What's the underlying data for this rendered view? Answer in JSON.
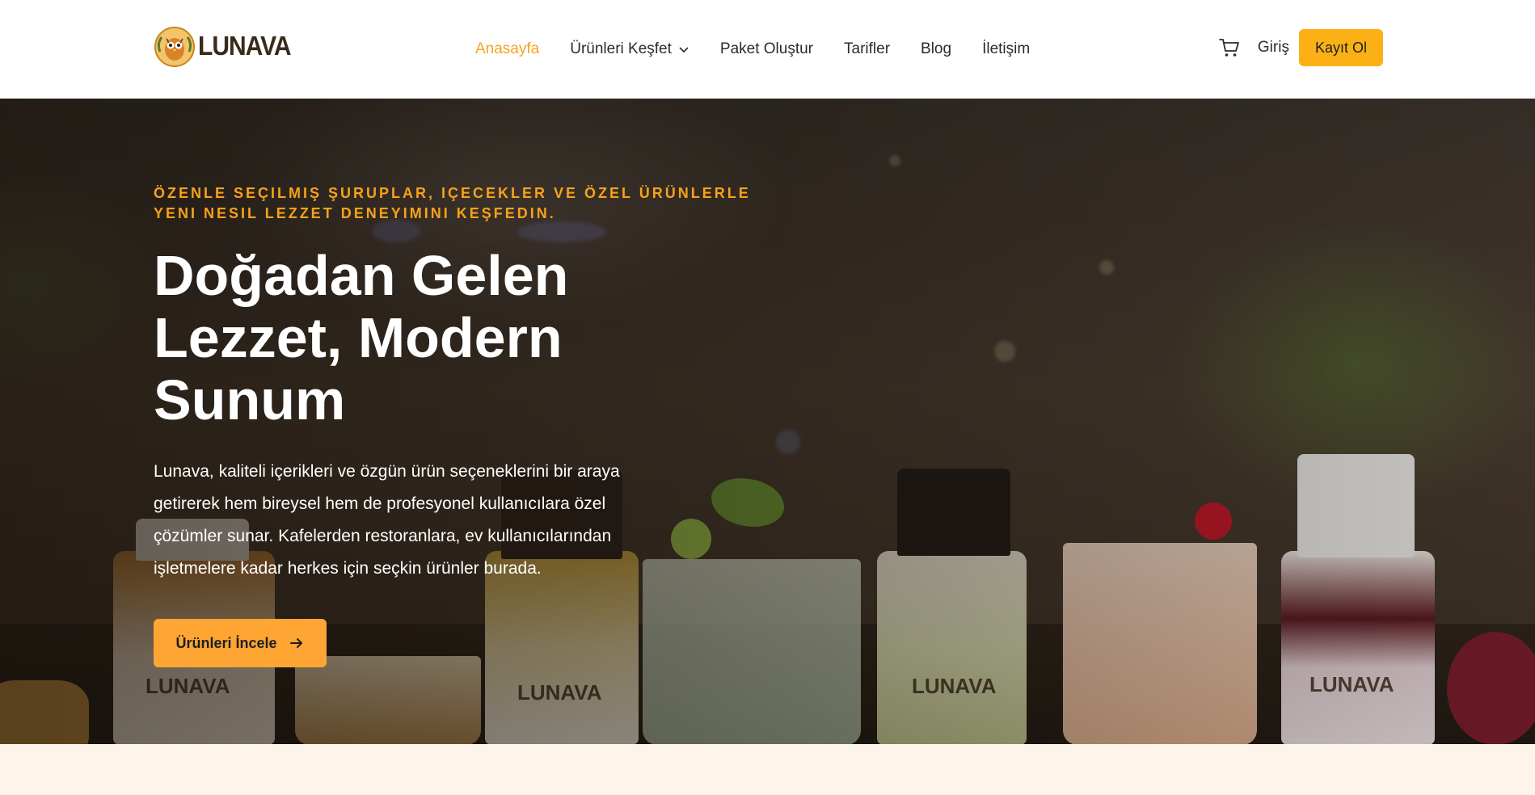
{
  "brand": {
    "name": "LUNAVA",
    "logo_icon": "owl-mascot-icon"
  },
  "nav": {
    "items": [
      {
        "label": "Anasayfa",
        "active": true
      },
      {
        "label": "Ürünleri Keşfet",
        "has_dropdown": true
      },
      {
        "label": "Paket Oluştur"
      },
      {
        "label": "Tarifler"
      },
      {
        "label": "Blog"
      },
      {
        "label": "İletişim"
      }
    ]
  },
  "header_actions": {
    "cart_icon": "shopping-cart-icon",
    "login_label": "Giriş",
    "register_label": "Kayıt Ol"
  },
  "hero": {
    "eyebrow_line1": "Özenle seçilmiş şuruplar, içecekler ve özel ürünlerle",
    "eyebrow_line2": "yeni nesil lezzet deneyimini keşfedin.",
    "title": "Doğadan Gelen Lezzet, Modern Sunum",
    "description": "Lunava, kaliteli içerikleri ve özgün ürün seçeneklerini bir araya getirerek hem bireysel hem de profesyonel kullanıcılara özel çözümler sunar. Kafelerden restoranlara, ev kullanıcılarından işletmelere kadar herkes için seçkin ürünler burada.",
    "cta_label": "Ürünleri İncele",
    "cta_icon": "arrow-right-icon",
    "bottle_label": "LUNAVA"
  },
  "colors": {
    "accent": "#f7a21b",
    "button": "#fbb116",
    "cta": "#ffa533",
    "page_background": "#fdf5ea"
  }
}
